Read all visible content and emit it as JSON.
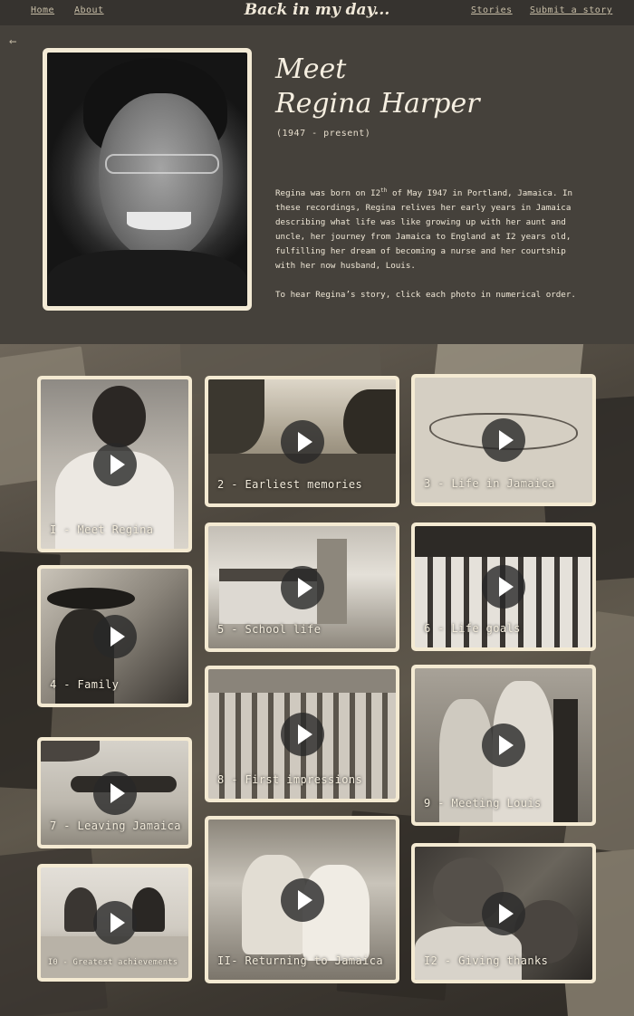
{
  "nav": {
    "home": "Home",
    "about": "About",
    "brand": "Back in my day...",
    "stories": "Stories",
    "submit": "Submit a story"
  },
  "profile": {
    "title_line1": "Meet",
    "title_line2": "Regina Harper",
    "dates": "(1947 - present)",
    "bio_part1": "Regina was born on I2",
    "bio_sup": "th",
    "bio_part2": " of May I947 in Portland, Jamaica. In these recordings, Regina relives her early years in Jamaica describing what life was like growing up with her aunt and uncle, her journey from Jamaica to England at I2 years old, fulfilling her dream of becoming a nurse and her courtship with her now husband, Louis.",
    "instruction": "To hear Regina’s story, click each photo in numerical order."
  },
  "icons": {
    "back": "arrow-left-icon",
    "play": "play-icon"
  },
  "colors": {
    "frame": "#f4ead2",
    "header_bg": "#45413b",
    "nav_bg": "#36332f"
  },
  "stories": [
    {
      "label": "I - Meet Regina"
    },
    {
      "label": "2 - Earliest memories"
    },
    {
      "label": "3 - Life in Jamaica"
    },
    {
      "label": "4 - Family"
    },
    {
      "label": "5 - School life"
    },
    {
      "label": "6 - Life goals"
    },
    {
      "label": "7 - Leaving Jamaica"
    },
    {
      "label": "8 - First impressions"
    },
    {
      "label": "9 - Meeting Louis"
    },
    {
      "label": "I0 - Greatest achievements"
    },
    {
      "label": "II- Returning to Jamaica"
    },
    {
      "label": "I2 - Giving thanks"
    }
  ]
}
